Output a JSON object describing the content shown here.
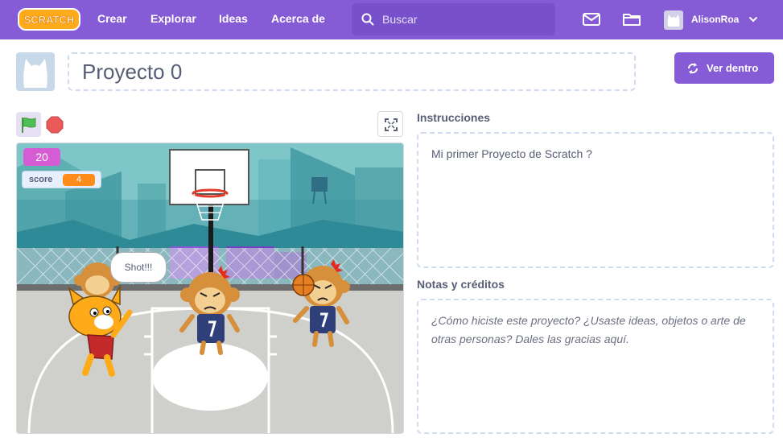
{
  "nav": {
    "logo_text": "SCRATCH",
    "links": [
      "Crear",
      "Explorar",
      "Ideas",
      "Acerca de"
    ],
    "search_placeholder": "Buscar",
    "icons": [
      "mail-icon",
      "folder-icon"
    ],
    "username": "AlisonRoa"
  },
  "project": {
    "title": "Proyecto 0",
    "see_inside_label": "Ver dentro"
  },
  "stage": {
    "timer_value": "20",
    "score_label": "score",
    "score_value": "4",
    "speech_text": "Shot!!!",
    "jersey_number": "7"
  },
  "instructions": {
    "heading": "Instrucciones",
    "text": "Mi primer Proyecto de Scratch ?"
  },
  "notes": {
    "heading": "Notas y créditos",
    "placeholder": "¿Cómo hiciste este proyecto? ¿Usaste ideas, objetos o arte de otras personas? Dales las gracias aquí."
  },
  "colors": {
    "brand": "#855cd6",
    "timer_monitor": "#d65cd6",
    "score_value": "#ff8c1a",
    "flag": "#4cbf56",
    "stop": "#ec5959"
  }
}
